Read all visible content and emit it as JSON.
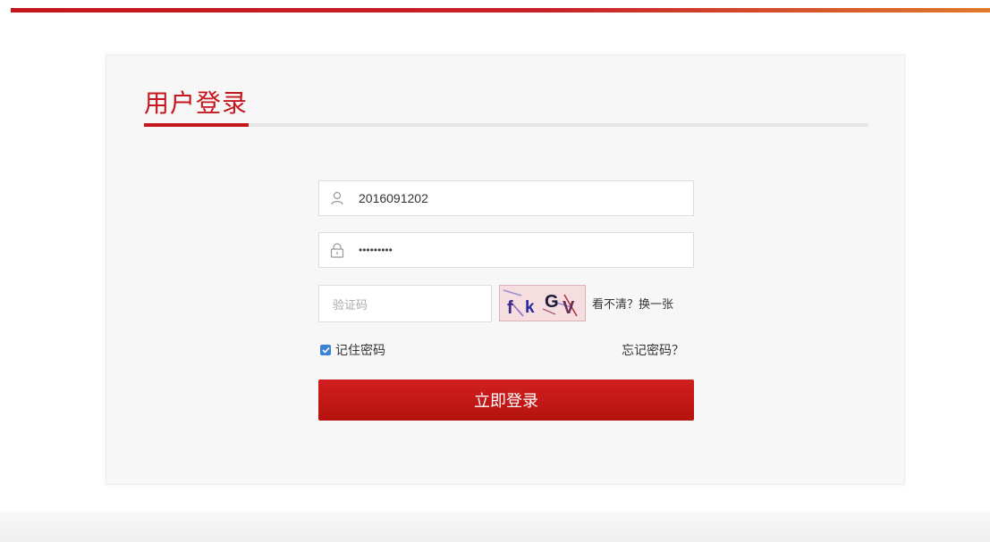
{
  "login": {
    "title": "用户登录",
    "username_value": "2016091202",
    "password_value": "•••••••••",
    "captcha_placeholder": "验证码",
    "captcha_chars": [
      "f",
      "k",
      "G",
      "V"
    ],
    "captcha_refresh_label": "看不清？换一张",
    "remember_label": "记住密码",
    "remember_checked": true,
    "forgot_label": "忘记密码？",
    "submit_label": "立即登录"
  },
  "colors": {
    "brand_red": "#c4161c",
    "button_red": "#c8161a",
    "checkbox_blue": "#3b82d6"
  },
  "icons": {
    "username": "user-icon",
    "password": "lock-icon",
    "checkbox": "check-icon"
  }
}
